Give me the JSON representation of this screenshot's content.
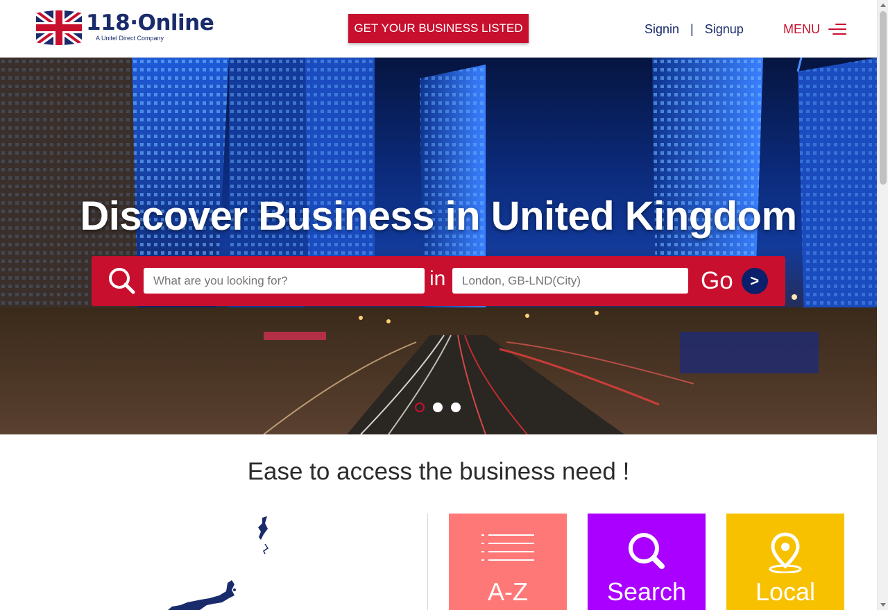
{
  "header": {
    "logo_name": "118·Online",
    "logo_tagline": "A Unitel Direct Company",
    "cta_label": "GET YOUR BUSINESS LISTED",
    "signin_label": "Signin",
    "separator": "|",
    "signup_label": "Signup",
    "menu_label": "MENU"
  },
  "hero": {
    "title": "Discover Business in United Kingdom",
    "search_placeholder": "What are you looking for?",
    "in_label": "in",
    "location_placeholder": "London, GB-LND(City)",
    "go_label": "Go",
    "go_arrow": ">",
    "slides": 3,
    "active_slide": 1
  },
  "section": {
    "title": "Ease to access the business need !"
  },
  "tiles": [
    {
      "label": "A-Z",
      "icon": "list-icon",
      "color": "#ff7878"
    },
    {
      "label": "Search",
      "icon": "search-icon",
      "color": "#aa00ff"
    },
    {
      "label": "Local",
      "icon": "location-pin-icon",
      "color": "#f8c100"
    }
  ],
  "colors": {
    "brand_red": "#c8102e",
    "brand_navy": "#1a2b6b"
  }
}
